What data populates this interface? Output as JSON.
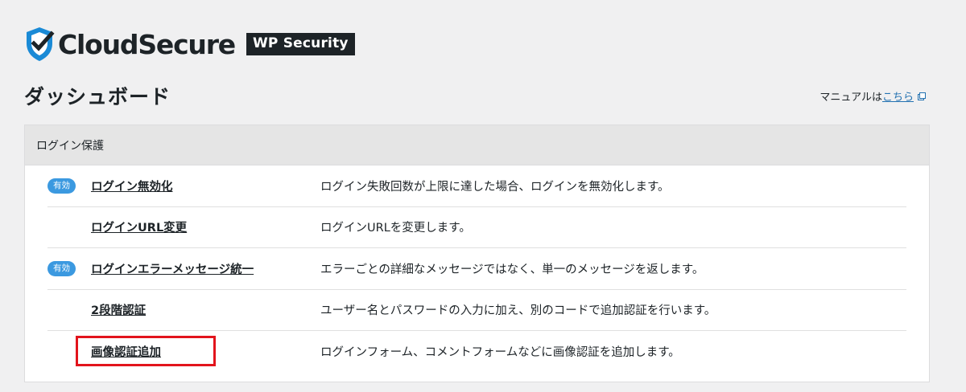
{
  "brand": {
    "name": "CloudSecure",
    "badge": "WP Security",
    "colors": {
      "shield": "#1a8ad6",
      "dark": "#1d2327"
    }
  },
  "page": {
    "title": "ダッシュボード",
    "manual_prefix": "マニュアルは",
    "manual_link": "こちら",
    "manual_icon": "external-link-icon"
  },
  "panel": {
    "title": "ログイン保護",
    "rows": [
      {
        "badge": "有効",
        "name": "ログイン無効化",
        "desc": "ログイン失敗回数が上限に達した場合、ログインを無効化します。"
      },
      {
        "badge": "",
        "name": "ログインURL変更",
        "desc": "ログインURLを変更します。"
      },
      {
        "badge": "有効",
        "name": "ログインエラーメッセージ統一",
        "desc": "エラーごとの詳細なメッセージではなく、単一のメッセージを返します。"
      },
      {
        "badge": "",
        "name": "2段階認証",
        "desc": "ユーザー名とパスワードの入力に加え、別のコードで追加認証を行います。"
      },
      {
        "badge": "",
        "name": "画像認証追加",
        "desc": "ログインフォーム、コメントフォームなどに画像認証を追加します。"
      }
    ]
  },
  "colors": {
    "badge": "#3b99e0",
    "link": "#2271b1",
    "highlight": "#e2141c"
  }
}
